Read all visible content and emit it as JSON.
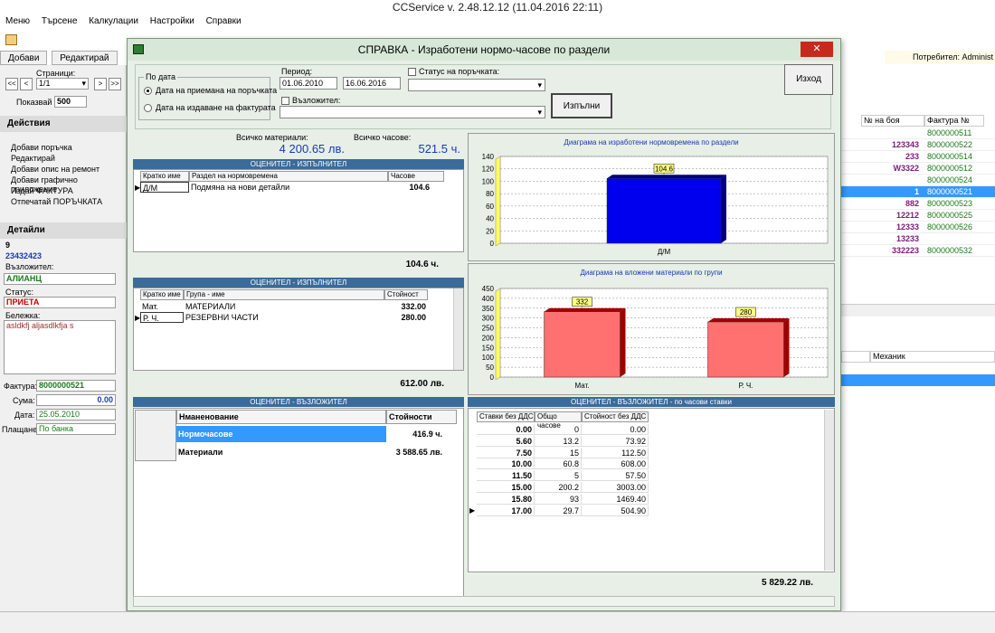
{
  "window": {
    "title": "CCService v. 2.48.12.12 (11.04.2016 22:11)"
  },
  "menu": [
    "Меню",
    "Търсене",
    "Калкулации",
    "Настройки",
    "Справки"
  ],
  "toolbar_tabs": [
    "Добави",
    "Редактирай"
  ],
  "user_label": "Потребител: Administ",
  "left": {
    "pages_label": "Страници:",
    "page_value": "1/1",
    "shown_label": "Показвай",
    "shown_value": "500",
    "actions_title": "Действия",
    "actions": [
      "Добави поръчка",
      "Редактирай",
      "Добави опис на ремонт",
      "Добави графично приложение",
      "Издай ФАКТУРА",
      "Отпечатай ПОРЪЧКАТА"
    ],
    "details_title": "Детайли",
    "detail_no": "9",
    "detail_code": "23432423",
    "assignor_label": "Възложител:",
    "assignor_value": "АЛИАНЦ",
    "status_label": "Статус:",
    "status_value": "ПРИЕТА",
    "note_label": "Бележка:",
    "note_value": "asldkfj aljasdlkfja s",
    "invoice_label": "Фактура:",
    "invoice_value": "8000000521",
    "sum_label": "Сума:",
    "sum_value": "0.00",
    "date_label": "Дата:",
    "date_value": "25.05.2010",
    "payment_label": "Плащане:",
    "payment_value": "По банка"
  },
  "right_grid": {
    "headers": [
      "№ на боя",
      "Фактура №"
    ],
    "rows": [
      {
        "paint": "",
        "invoice": "8000000511"
      },
      {
        "paint": "123343",
        "invoice": "8000000522"
      },
      {
        "paint": "233",
        "invoice": "8000000514"
      },
      {
        "paint": "W3322",
        "invoice": "8000000512"
      },
      {
        "paint": "",
        "invoice": "8000000524"
      },
      {
        "paint": "1",
        "invoice": "8000000521"
      },
      {
        "paint": "882",
        "invoice": "8000000523"
      },
      {
        "paint": "12212",
        "invoice": "8000000525"
      },
      {
        "paint": "12333",
        "invoice": "8000000526"
      },
      {
        "paint": "13233",
        "invoice": ""
      },
      {
        "paint": "332223",
        "invoice": "8000000532"
      }
    ],
    "mechanic_header": "Механик"
  },
  "dialog": {
    "title": "СПРАВКА - Изработени нормо-часове по раздели",
    "close": "✕",
    "by_date_group": "По дата",
    "radio1": "Дата на приемана на поръчката",
    "radio2": "Дата на издаване на фактурата",
    "period_label": "Период:",
    "date_from": "01.06.2010",
    "date_to": "16.06.2016",
    "status_label": "Статус на поръчката:",
    "assignor_label": "Възложител:",
    "run_button": "Изпълни",
    "exit_button": "Изход",
    "total_materials_label": "Всичко материали:",
    "total_materials_value": "4 200.65 лв.",
    "total_hours_label": "Всичко часове:",
    "total_hours_value": "521.5 ч.",
    "sec1": {
      "title": "ОЦЕНИТЕЛ - ИЗПЪЛНИТЕЛ",
      "headers": [
        "Кратко име",
        "Раздел на нормовремена",
        "Часове"
      ],
      "rows": [
        {
          "short": "Д/М",
          "name": "Подмяна на нови детайли",
          "val": "104.6"
        }
      ],
      "total": "104.6 ч."
    },
    "sec2": {
      "title": "ОЦЕНИТЕЛ - ИЗПЪЛНИТЕЛ",
      "headers": [
        "Кратко име",
        "Група - име",
        "Стойност"
      ],
      "rows": [
        {
          "short": "Мат.",
          "name": "МАТЕРИАЛИ",
          "val": "332.00"
        },
        {
          "short": "Р. Ч.",
          "name": "РЕЗЕРВНИ ЧАСТИ",
          "val": "280.00"
        }
      ],
      "total": "612.00 лв."
    },
    "sec3": {
      "title": "ОЦЕНИТЕЛ - ВЪЗЛОЖИТЕЛ",
      "headers": [
        "Нманенование",
        "Стойности"
      ],
      "rows": [
        {
          "name": "Нормочасове",
          "val": "416.9 ч."
        },
        {
          "name": "Материали",
          "val": "3 588.65 лв."
        }
      ]
    },
    "sec4": {
      "title": "ОЦЕНИТЕЛ - ВЪЗЛОЖИТЕЛ - по часови ставки",
      "headers": [
        "Ставки без ДДС",
        "Общо часове",
        "Стойност без ДДС"
      ],
      "rows": [
        [
          "0.00",
          "0",
          "0.00"
        ],
        [
          "5.60",
          "13.2",
          "73.92"
        ],
        [
          "7.50",
          "15",
          "112.50"
        ],
        [
          "10.00",
          "60.8",
          "608.00"
        ],
        [
          "11.50",
          "5",
          "57.50"
        ],
        [
          "15.00",
          "200.2",
          "3003.00"
        ],
        [
          "15.80",
          "93",
          "1469.40"
        ],
        [
          "17.00",
          "29.7",
          "504.90"
        ]
      ],
      "total": "5 829.22 лв."
    }
  },
  "chart_data": [
    {
      "type": "bar",
      "title": "Диаграма на изработени нормовремена по раздели",
      "categories": [
        "Д/М"
      ],
      "values": [
        104.6
      ],
      "data_labels": [
        "104.6"
      ],
      "ylim": [
        0,
        140
      ],
      "yticks": [
        0,
        20,
        40,
        60,
        80,
        100,
        120,
        140
      ],
      "color": "#0000ee"
    },
    {
      "type": "bar",
      "title": "Диаграма на вложени материали по групи",
      "categories": [
        "Мат.",
        "Р. Ч."
      ],
      "values": [
        332,
        280
      ],
      "data_labels": [
        "332",
        "280"
      ],
      "ylim": [
        0,
        450
      ],
      "yticks": [
        0,
        50,
        100,
        150,
        200,
        250,
        300,
        350,
        400,
        450
      ],
      "color": "#ff7070"
    }
  ]
}
